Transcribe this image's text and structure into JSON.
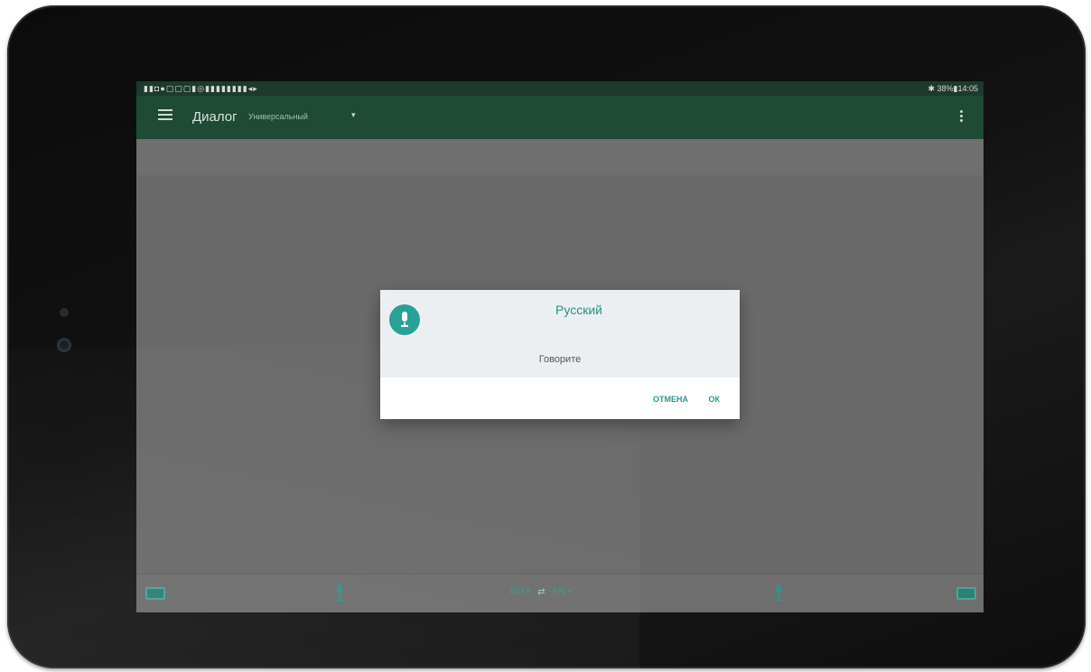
{
  "status_bar": {
    "left_icons": "▮▮◘●▢▢▢▮◎▮▮▮▮▮▮▮▮◂▸",
    "right_text": "✱ 38%▮14:05"
  },
  "app_bar": {
    "title": "Диалог",
    "mode": "Универсальный",
    "mode_caret": "▾",
    "menu_icon": "hamburger-icon",
    "overflow_icon": "more-vert-icon"
  },
  "dialog": {
    "language": "Русский",
    "prompt": "Говорите",
    "cancel_label": "ОТМЕНА",
    "ok_label": "ОК",
    "icon": "microphone-icon",
    "accent_color": "#28a197"
  },
  "bottom_bar": {
    "source_lang": "RU ▾",
    "swap_symbol": "⇄",
    "target_lang": "EN ▾",
    "left_keyboard_icon": "keyboard-icon",
    "right_keyboard_icon": "keyboard-icon",
    "mic_icon": "microphone-icon"
  },
  "colors": {
    "app_bar": "#1f4a35",
    "status_bar": "#1d3a2c",
    "accent": "#28a197",
    "scrim": "#6b6b6b"
  }
}
